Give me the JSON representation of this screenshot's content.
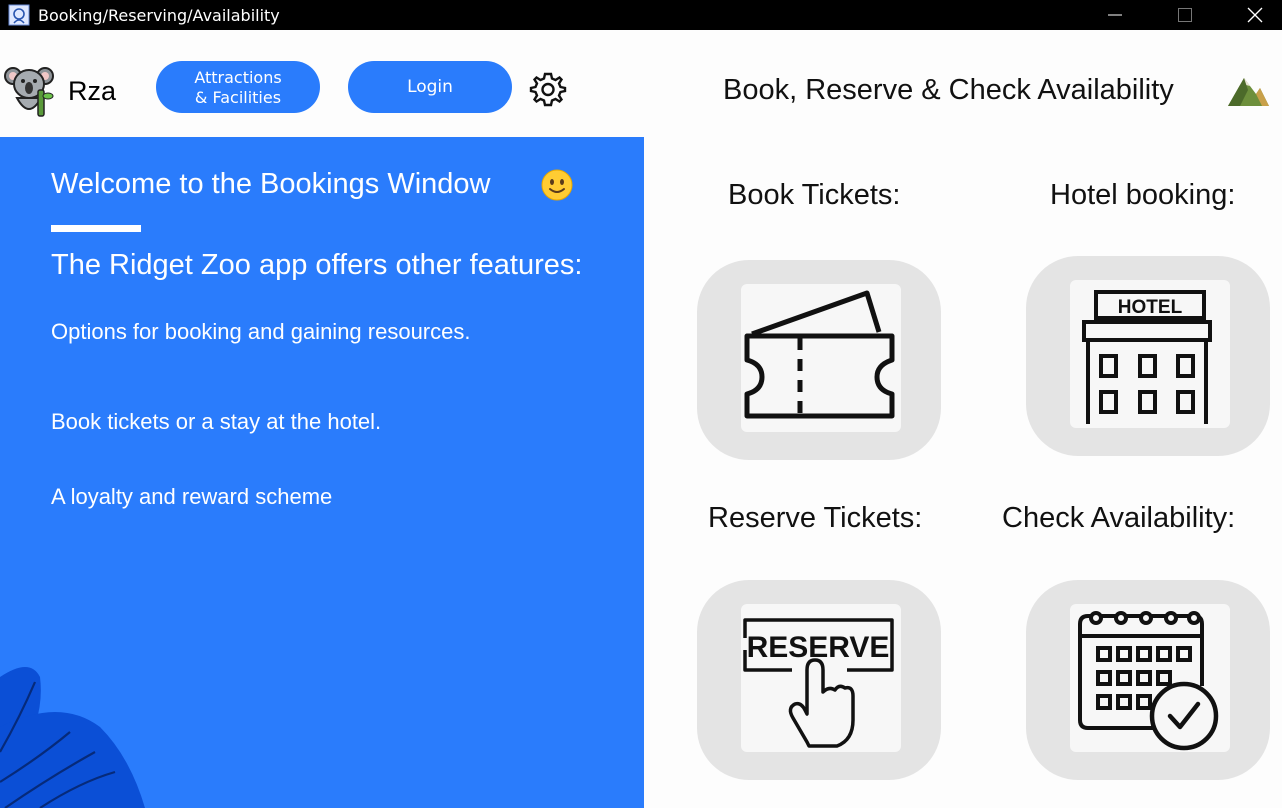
{
  "window": {
    "title": "Booking/Reserving/Availability"
  },
  "header": {
    "brand": "Rza",
    "attractions_line1": "Attractions",
    "attractions_line2": "& Facilities",
    "login": "Login",
    "page_title": "Book, Reserve & Check Availability"
  },
  "left_panel": {
    "welcome": "Welcome to the Bookings Window",
    "features_heading": "The Ridget Zoo app offers other features:",
    "lines": [
      "Options for booking and gaining resources.",
      "Book tickets or a stay at the hotel.",
      "A loyalty and reward scheme"
    ]
  },
  "options": {
    "book_tickets": "Book Tickets:",
    "hotel_booking": "Hotel booking:",
    "reserve_tickets": "Reserve Tickets:",
    "check_availability": "Check Availability:",
    "hotel_sign": "HOTEL",
    "reserve_sign": "RESERVE"
  },
  "colors": {
    "accent_blue": "#2a7cfc",
    "titlebar": "#000000",
    "tile_bg": "#e4e4e4"
  },
  "icons": {
    "app": "app-icon",
    "minimize": "minimize-icon",
    "maximize": "maximize-icon",
    "close": "close-icon",
    "logo": "koala-logo-icon",
    "settings": "gear-icon",
    "mountain": "mountain-icon",
    "smiley": "smiley-icon",
    "ticket": "ticket-icon",
    "hotel": "hotel-icon",
    "reserve": "reserve-icon",
    "calendar": "calendar-check-icon"
  }
}
